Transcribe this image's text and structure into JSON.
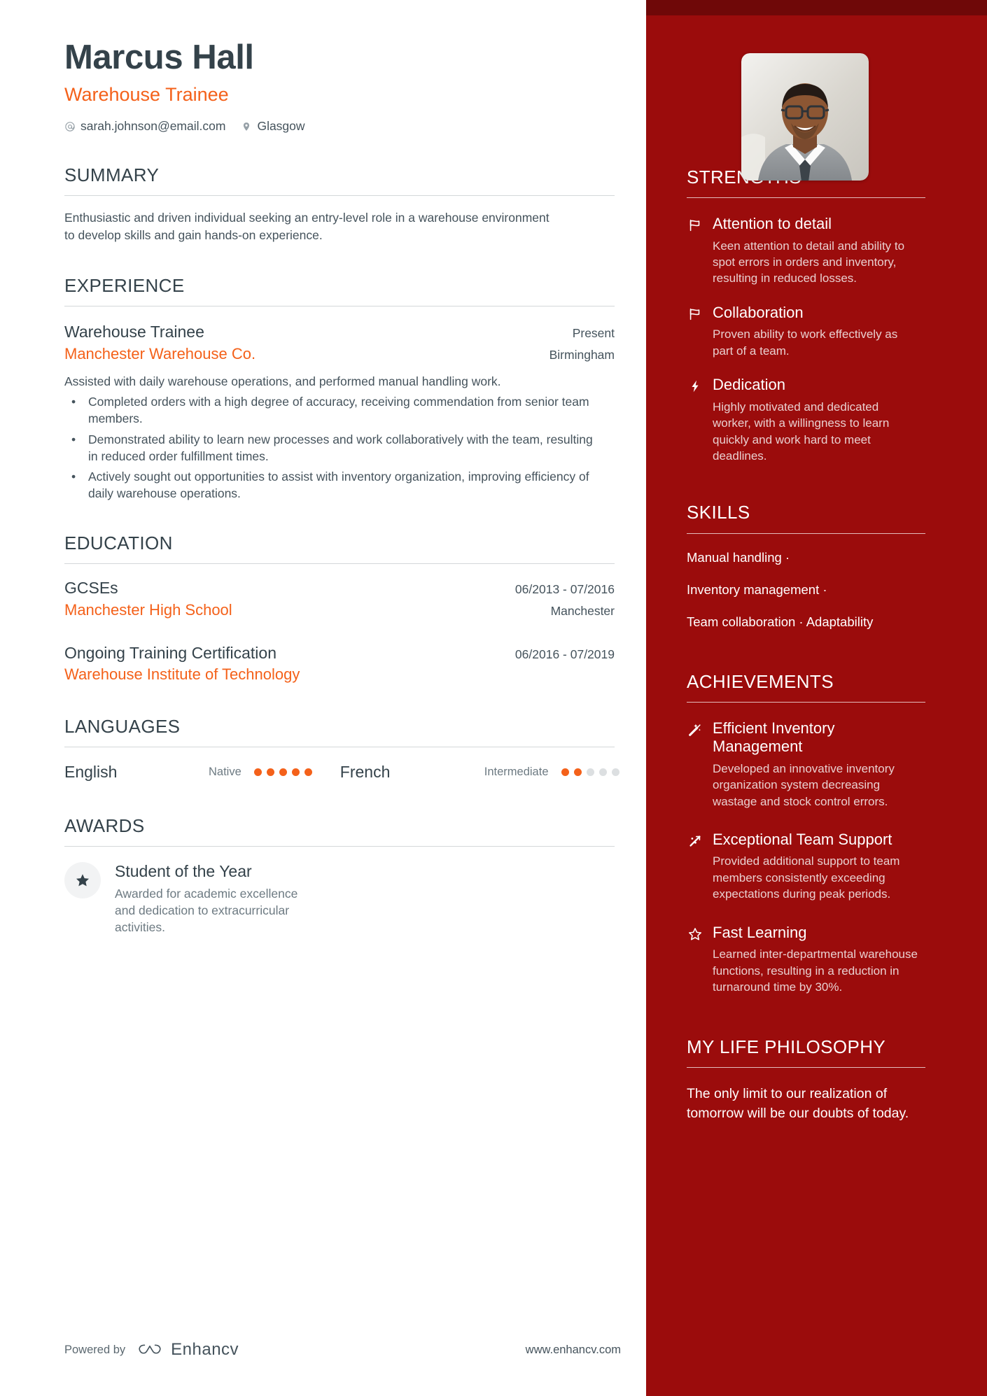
{
  "header": {
    "name": "Marcus Hall",
    "role": "Warehouse Trainee",
    "email": "sarah.johnson@email.com",
    "location": "Glasgow",
    "email_icon": "at-icon",
    "location_icon": "map-pin-icon",
    "photo_alt": "profile-photo"
  },
  "colors": {
    "accent_orange": "#f4611a",
    "sidebar_red": "#9b0c0c",
    "sidebar_top_strip": "#6f0808",
    "heading_dark": "#34424a",
    "body_gray": "#45535c"
  },
  "summary": {
    "title": "SUMMARY",
    "text": "Enthusiastic and driven individual seeking an entry-level role in a warehouse environment to develop skills and gain hands-on experience."
  },
  "experience": {
    "title": "EXPERIENCE",
    "entries": [
      {
        "position": "Warehouse Trainee",
        "date": "Present",
        "company": "Manchester Warehouse Co.",
        "location": "Birmingham",
        "description": "Assisted with daily warehouse operations, and performed manual handling work.",
        "bullets": [
          "Completed orders with a high degree of accuracy, receiving commendation from senior team members.",
          "Demonstrated ability to learn new processes and work collaboratively with the team, resulting in reduced order fulfillment times.",
          "Actively sought out opportunities to assist with inventory organization, improving efficiency of daily warehouse operations."
        ]
      }
    ]
  },
  "education": {
    "title": "EDUCATION",
    "entries": [
      {
        "degree": "GCSEs",
        "date": "06/2013 - 07/2016",
        "school": "Manchester High School",
        "location": "Manchester"
      },
      {
        "degree": "Ongoing Training Certification",
        "date": "06/2016 - 07/2019",
        "school": "Warehouse Institute of Technology",
        "location": ""
      }
    ]
  },
  "languages": {
    "title": "LANGUAGES",
    "items": [
      {
        "name": "English",
        "level": "Native",
        "rating": 5,
        "max": 5
      },
      {
        "name": "French",
        "level": "Intermediate",
        "rating": 2,
        "max": 5
      }
    ]
  },
  "awards": {
    "title": "AWARDS",
    "items": [
      {
        "icon": "star-filled-icon",
        "title": "Student of the Year",
        "description": "Awarded for academic excellence and dedication to extracurricular activities."
      }
    ]
  },
  "strengths": {
    "title": "STRENGTHS",
    "items": [
      {
        "icon": "flag-icon",
        "title": "Attention to detail",
        "description": "Keen attention to detail and ability to spot errors in orders and inventory, resulting in reduced losses."
      },
      {
        "icon": "flag-icon",
        "title": "Collaboration",
        "description": "Proven ability to work effectively as part of a team."
      },
      {
        "icon": "lightning-bolt-icon",
        "title": "Dedication",
        "description": "Highly motivated and dedicated worker, with a willingness to learn quickly and work hard to meet deadlines."
      }
    ]
  },
  "skills": {
    "title": "SKILLS",
    "lines": [
      "Manual handling ·",
      "Inventory management ·",
      "Team collaboration · Adaptability"
    ],
    "items": [
      "Manual handling",
      "Inventory management",
      "Team collaboration",
      "Adaptability"
    ]
  },
  "achievements": {
    "title": "ACHIEVEMENTS",
    "items": [
      {
        "icon": "magic-wand-icon",
        "title": "Efficient Inventory Management",
        "description": "Developed an innovative inventory organization system decreasing wastage and stock control errors."
      },
      {
        "icon": "rocket-icon",
        "title": "Exceptional Team Support",
        "description": "Provided additional support to team members consistently exceeding expectations during peak periods."
      },
      {
        "icon": "star-outline-icon",
        "title": "Fast Learning",
        "description": "Learned inter-departmental warehouse functions, resulting in a reduction in turnaround time by 30%."
      }
    ]
  },
  "philosophy": {
    "title": "MY LIFE PHILOSOPHY",
    "quote": "The only limit to our realization of tomorrow will be our doubts of today."
  },
  "footer": {
    "powered_by": "Powered by",
    "brand": "Enhancv",
    "brand_icon": "enhancv-logo-icon",
    "url": "www.enhancv.com"
  }
}
